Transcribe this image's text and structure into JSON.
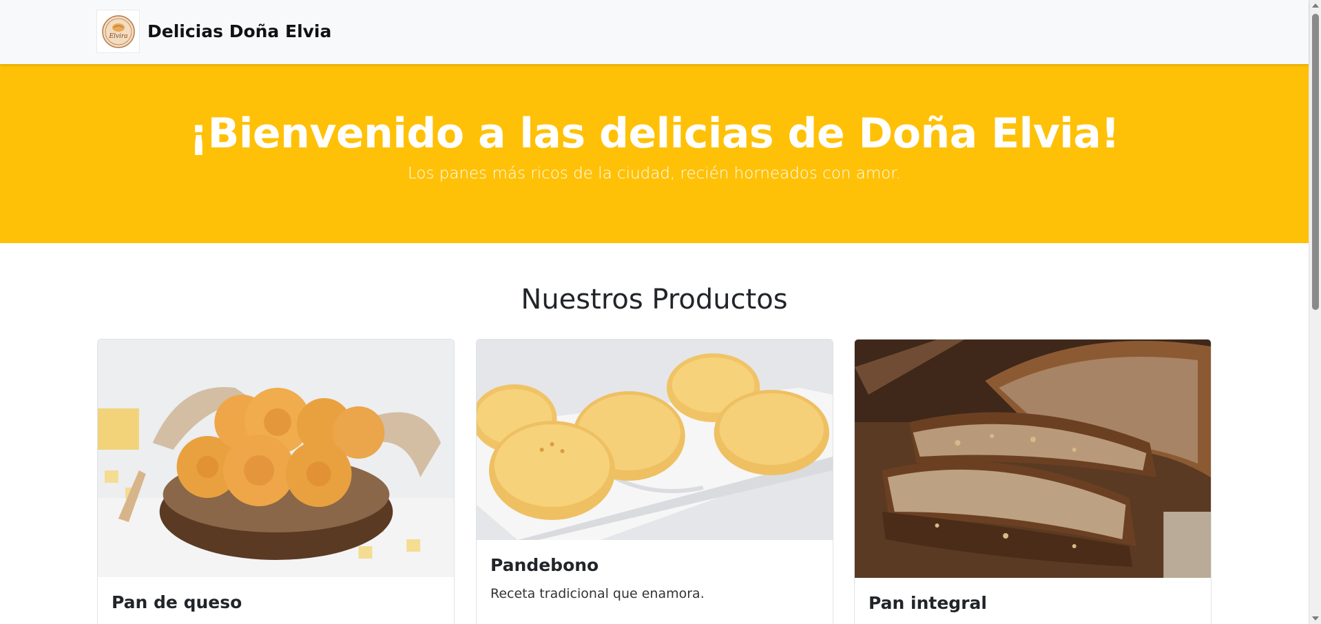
{
  "navbar": {
    "brand_name": "Delicias Doña Elvia",
    "logo_text": "Elvira",
    "logo_icon": "bread-logo-icon"
  },
  "hero": {
    "title": "¡Bienvenido a las delicias de Doña Elvia!",
    "subtitle": "Los panes más ricos de la ciudad, recién horneados con amor."
  },
  "products": {
    "section_title": "Nuestros Productos",
    "items": [
      {
        "name": "Pan de queso",
        "description": "",
        "price": "",
        "image_icon": "cheese-bread-basket-image"
      },
      {
        "name": "Pandebono",
        "description": "Receta tradicional que enamora.",
        "price": "",
        "image_icon": "pandebono-image"
      },
      {
        "name": "Pan integral",
        "description": "",
        "price": "",
        "image_icon": "whole-wheat-bread-image"
      }
    ]
  },
  "colors": {
    "hero_bg": "#ffc107",
    "navbar_bg": "#f8f9fa",
    "price_badge": "#198754"
  }
}
